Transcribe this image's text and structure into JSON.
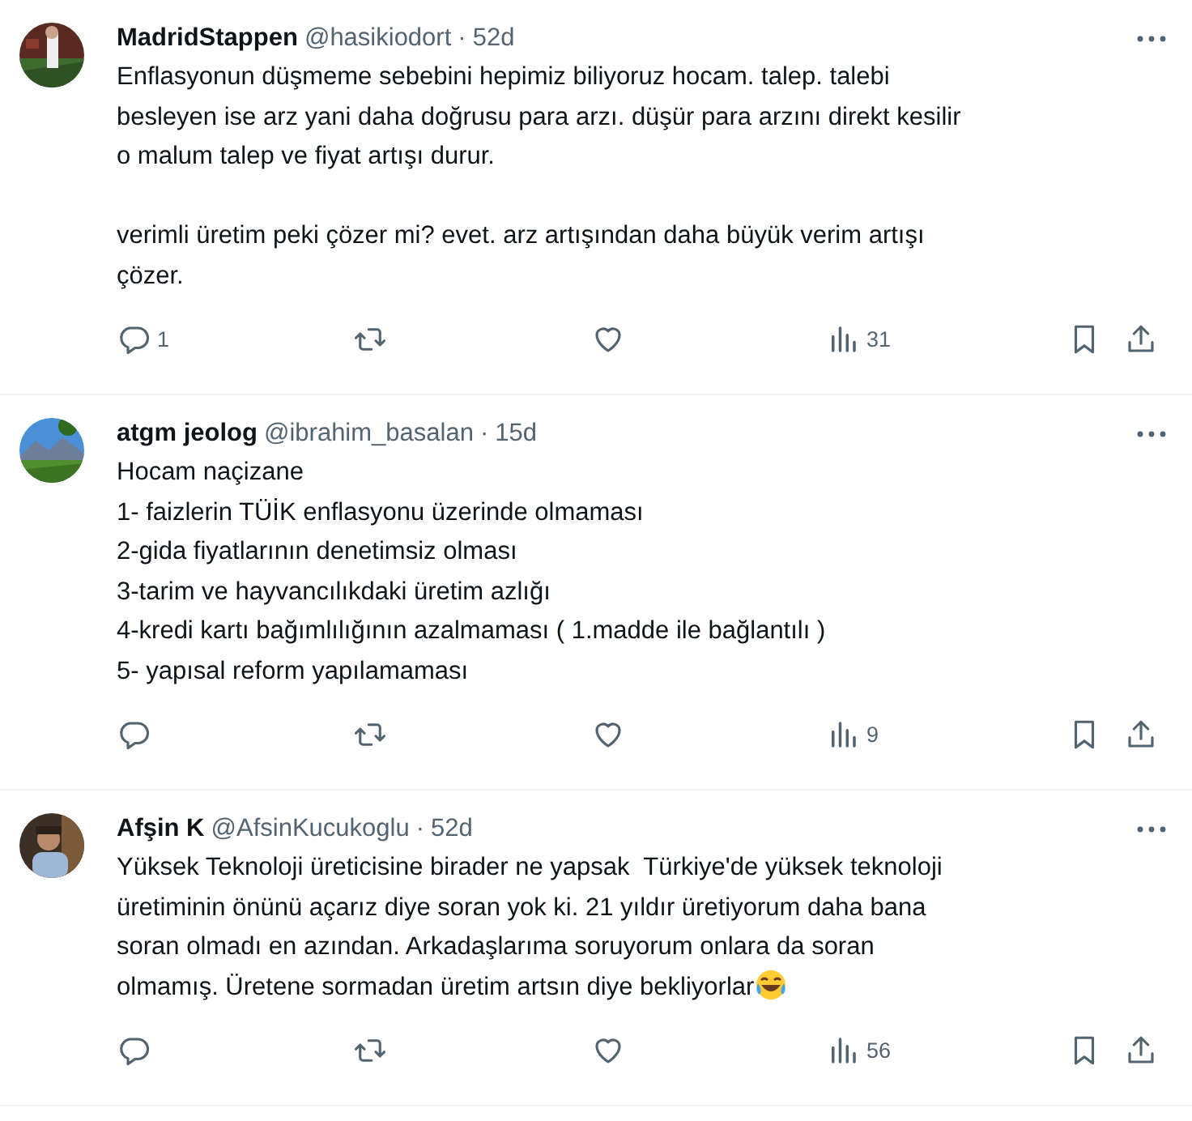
{
  "replies": [
    {
      "name": "MadridStappen",
      "handle": "@hasikiodort",
      "separator": "·",
      "time": "52d",
      "text": "Enflasyonun düşmeme sebebini hepimiz biliyoruz hocam. talep. talebi\nbesleyen ise arz yani daha doğrusu para arzı. düşür para arzını direkt kesilir\no malum talep ve fiyat artışı durur.\n\nverimli üretim peki çözer mi? evet. arz artışından daha büyük verim artışı\nçözer.",
      "ends_with_emoji": false,
      "reply_count": "1",
      "views": "31"
    },
    {
      "name": "atgm jeolog",
      "handle": "@ibrahim_basalan",
      "separator": "·",
      "time": "15d",
      "text": "Hocam naçizane\n1- faizlerin TÜİK enflasyonu üzerinde olmaması\n2-gida fiyatlarının denetimsiz olması\n3-tarim ve hayvancılıkdaki üretim azlığı\n4-kredi kartı bağımlılığının azalmaması ( 1.madde ile bağlantılı )\n5- yapısal reform yapılamaması",
      "ends_with_emoji": false,
      "views": "9"
    },
    {
      "name": "Afşin K",
      "handle": "@AfsinKucukoglu",
      "separator": "·",
      "time": "52d",
      "text": "Yüksek Teknoloji üreticisine birader ne yapsak  Türkiye'de yüksek teknoloji\nüretiminin önünü açarız diye soran yok ki. 21 yıldır üretiyorum daha bana\nsoran olmadı en azından. Arkadaşlarıma soruyorum onlara da soran\nolmamış. Üretene sormadan üretim artsın diye bekliyorlar",
      "ends_with_emoji": true,
      "views": "56"
    }
  ]
}
